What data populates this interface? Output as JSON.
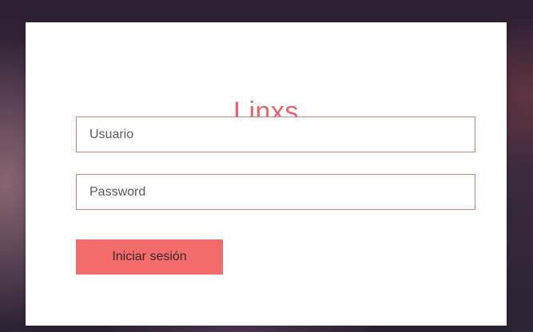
{
  "login": {
    "brand": "Linxs",
    "username_placeholder": "Usuario",
    "password_placeholder": "Password",
    "submit_label": "Iniciar sesión"
  },
  "colors": {
    "brand": "#e8636a",
    "field_border": "#e27a80",
    "button_background": "#f46b6b",
    "card_background": "#ffffff"
  }
}
